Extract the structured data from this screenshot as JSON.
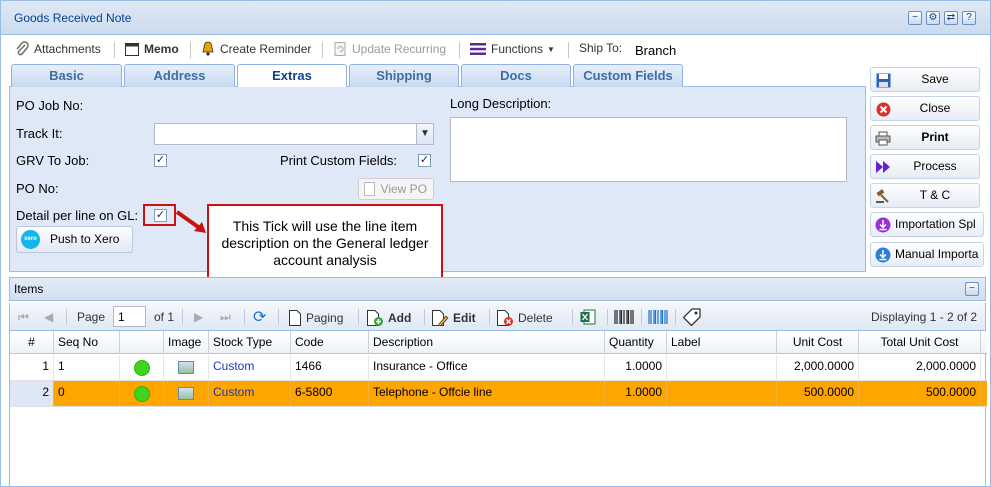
{
  "window": {
    "title": "Goods Received Note",
    "controls": [
      "−",
      "⚙",
      "⇄",
      "?"
    ]
  },
  "toolbar": {
    "attachments": "Attachments",
    "memo": "Memo",
    "reminder": "Create Reminder",
    "update_recurring": "Update Recurring",
    "functions": "Functions",
    "ship_to_label": "Ship To:",
    "ship_to_value": "Branch"
  },
  "tabs": [
    "Basic",
    "Address",
    "Extras",
    "Shipping",
    "Docs",
    "Custom Fields"
  ],
  "active_tab": "Extras",
  "form": {
    "po_job_no": "PO Job No:",
    "track_it": "Track It:",
    "grv_to_job": "GRV To Job:",
    "print_custom_fields": "Print Custom Fields:",
    "po_no": "PO No:",
    "view_po": "View PO",
    "detail_per_line": "Detail per line on GL:",
    "push_to_xero": "Push to Xero",
    "xero_logo": "xero",
    "long_description": "Long Description:",
    "checks": {
      "grv_to_job": true,
      "print_custom_fields": true,
      "detail_per_line": true
    }
  },
  "callout": {
    "text": "This Tick will use the line item description on the General ledger account analysis"
  },
  "side_buttons": [
    "Save",
    "Close",
    "Print",
    "Process",
    "T & C",
    "Importation Spl",
    "Manual Importa"
  ],
  "items": {
    "title": "Items",
    "pager": {
      "page_label": "Page",
      "page_value": "1",
      "of": "of 1",
      "paging": "Paging",
      "add": "Add",
      "edit": "Edit",
      "delete": "Delete",
      "displaying": "Displaying 1 - 2 of 2"
    },
    "columns": [
      "#",
      "Seq No",
      "",
      "Image",
      "Stock Type",
      "Code",
      "Description",
      "Quantity",
      "Label",
      "Unit Cost",
      "Total Unit Cost"
    ],
    "rows": [
      {
        "num": "1",
        "seq": "1",
        "stock_type": "Custom",
        "code": "1466",
        "description": "Insurance - Office",
        "quantity": "1.0000",
        "label": "",
        "unit_cost": "2,000.0000",
        "total": "2,000.0000"
      },
      {
        "num": "2",
        "seq": "0",
        "stock_type": "Custom",
        "code": "6-5800",
        "description": "Telephone - Offcie line",
        "quantity": "1.0000",
        "label": "",
        "unit_cost": "500.0000",
        "total": "500.0000"
      }
    ]
  },
  "colors": {
    "selected_row": "#ffa500",
    "status_dot": "#3fd21e",
    "callout_border": "#cc1111"
  }
}
